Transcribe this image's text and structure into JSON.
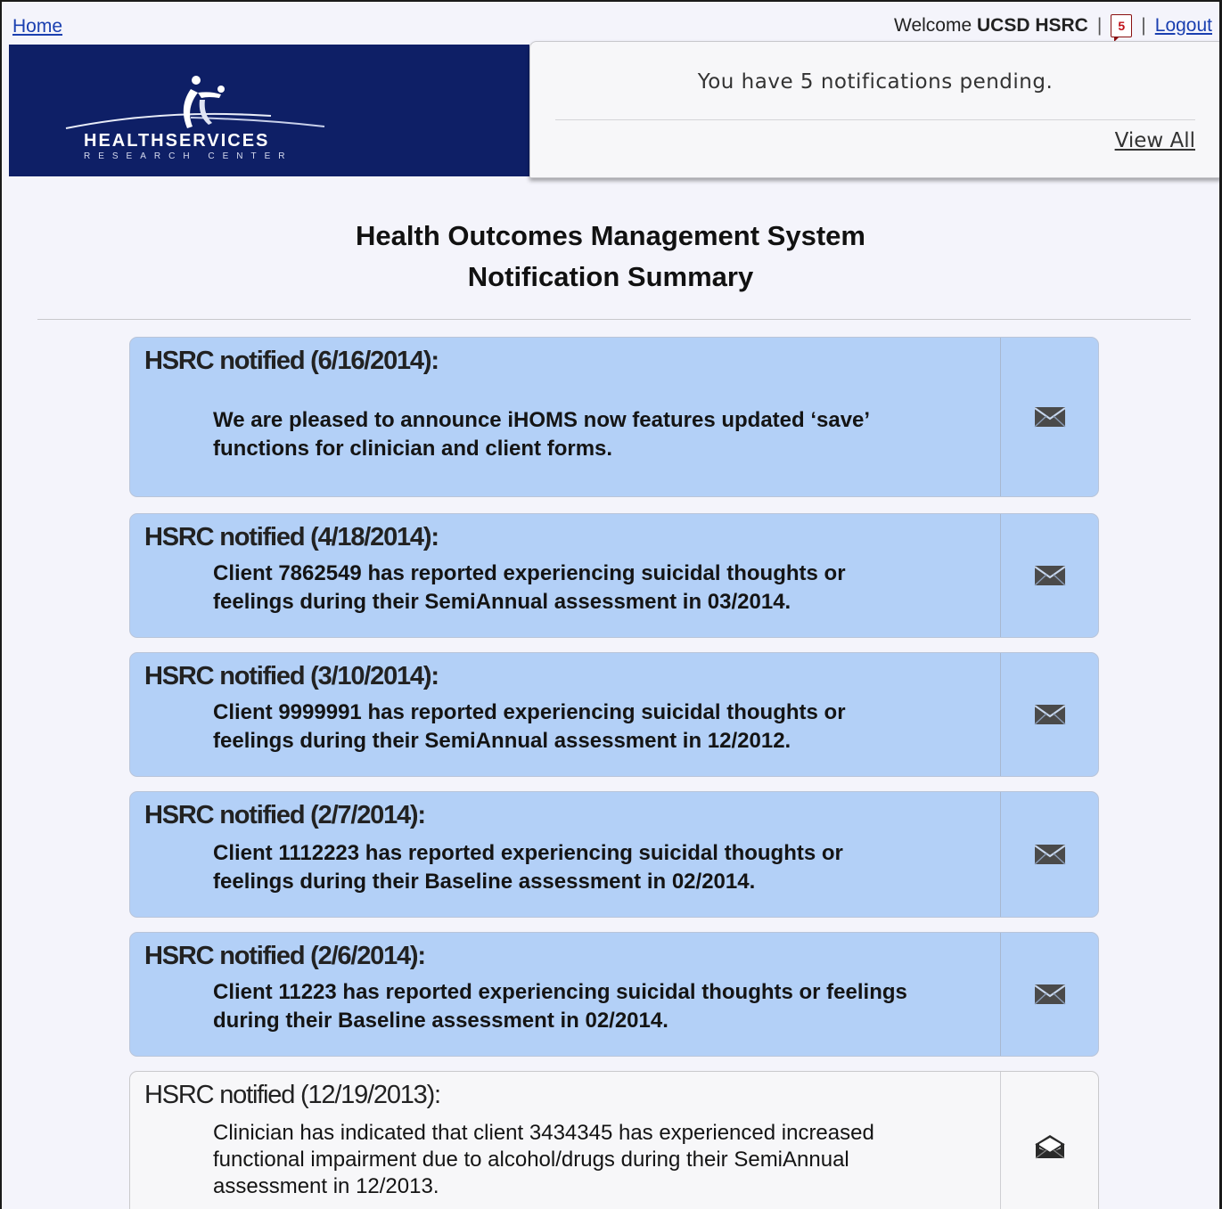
{
  "topbar": {
    "home_label": "Home",
    "welcome_label": "Welcome",
    "user_name": "UCSD HSRC",
    "separator": "|",
    "notification_count": "5",
    "logout_label": "Logout"
  },
  "banner": {
    "logo_title": "HEALTHSERVICES",
    "logo_subtitle": "RESEARCH CENTER",
    "bg_color": "#0e1f66"
  },
  "popup": {
    "message": "You have 5 notifications pending.",
    "view_all_label": "View All"
  },
  "page": {
    "title_line1": "Health Outcomes Management System",
    "title_line2": "Notification Summary"
  },
  "colors": {
    "unread_bg": "#b3d0f7",
    "read_bg": "#f7f7f9",
    "link": "#1a3fb0",
    "badge": "#c0121a"
  },
  "notifications": [
    {
      "header": "HSRC notified (6/16/2014):",
      "text": "We are pleased to announce iHOMS now features updated ‘save’ functions for clinician and client forms.",
      "status": "unread",
      "icon": "envelope-closed-icon"
    },
    {
      "header": "HSRC notified (4/18/2014):",
      "text": "Client 7862549 has reported experiencing suicidal thoughts or feelings during their SemiAnnual assessment in 03/2014.",
      "status": "unread",
      "icon": "envelope-closed-icon"
    },
    {
      "header": "HSRC notified (3/10/2014):",
      "text": "Client 9999991 has reported experiencing suicidal thoughts or feelings during their SemiAnnual assessment in 12/2012.",
      "status": "unread",
      "icon": "envelope-closed-icon"
    },
    {
      "header": "HSRC notified (2/7/2014):",
      "text": "Client 1112223 has reported experiencing suicidal thoughts or feelings during their Baseline assessment in 02/2014.",
      "status": "unread",
      "icon": "envelope-closed-icon"
    },
    {
      "header": "HSRC notified (2/6/2014):",
      "text": "Client 11223 has reported experiencing suicidal thoughts or feelings during their Baseline assessment in 02/2014.",
      "status": "unread",
      "icon": "envelope-closed-icon"
    },
    {
      "header": "HSRC notified (12/19/2013):",
      "text": "Clinician has indicated that client 3434345 has experienced increased functional impairment due to alcohol/drugs during their SemiAnnual assessment in 12/2013.",
      "status": "read",
      "icon": "envelope-open-icon"
    }
  ]
}
